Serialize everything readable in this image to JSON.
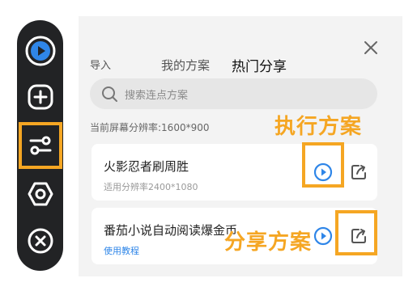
{
  "toolbar": {
    "items": [
      {
        "icon": "record-icon"
      },
      {
        "icon": "add-icon"
      },
      {
        "icon": "sliders-icon"
      },
      {
        "icon": "settings-hex-icon"
      },
      {
        "icon": "close-circle-icon"
      }
    ],
    "highlighted_item": "sliders-icon",
    "highlight_color": "#f5a623"
  },
  "tabs": [
    {
      "label": "导入",
      "active": false
    },
    {
      "label": "我的方案",
      "active": false
    },
    {
      "label": "热门分享",
      "active": true
    }
  ],
  "search": {
    "placeholder": "搜索连点方案"
  },
  "resolution_text": "当前屏幕分辨率:1600*900",
  "annotations": {
    "execute_label": "执行方案",
    "share_label": "分享方案"
  },
  "cards": [
    {
      "name": "火影忍者刷周胜",
      "subtitle": "适用分辨率2400*1080"
    },
    {
      "name": "番茄小说自动阅读爆金币",
      "subtitle": "使用教程"
    }
  ],
  "colors": {
    "accent": "#f5a623",
    "play": "#2f86e8",
    "link": "#2f86e8",
    "toolbar_bg": "#222325"
  }
}
